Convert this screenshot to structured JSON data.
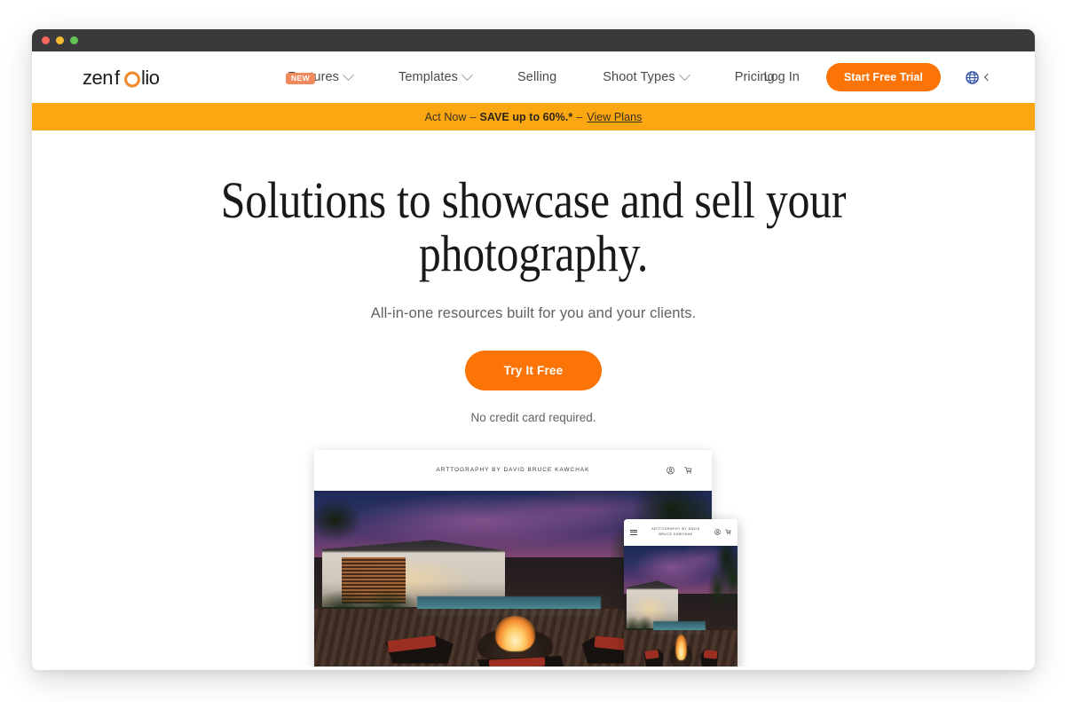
{
  "window": {
    "traffic_lights": [
      "close",
      "minimize",
      "maximize"
    ]
  },
  "nav": {
    "logo_text": "zenfolio",
    "items": [
      {
        "label": "Features",
        "has_caret": true,
        "badge": "NEW"
      },
      {
        "label": "Templates",
        "has_caret": true,
        "badge": ""
      },
      {
        "label": "Selling",
        "has_caret": false,
        "badge": ""
      },
      {
        "label": "Shoot Types",
        "has_caret": true,
        "badge": ""
      },
      {
        "label": "Pricing",
        "has_caret": false,
        "badge": ""
      }
    ],
    "login_label": "Log In",
    "cta_label": "Start Free Trial",
    "language_icon": "globe-icon"
  },
  "promo": {
    "lead": "Act Now",
    "dash1": "–",
    "highlight": "SAVE up to 60%.*",
    "dash2": "–",
    "link_label": "View Plans",
    "background": "#fba711"
  },
  "hero": {
    "headline_line1": "Solutions to showcase and sell your",
    "headline_line2": "photography.",
    "subhead": "All-in-one resources built for you and your clients.",
    "cta_label": "Try It Free",
    "note": "No credit card required."
  },
  "mockup": {
    "desktop": {
      "site_title": "ARTTOGRAPHY BY DAVID BRUCE KAWCHAK",
      "icons": [
        "user-circle-icon",
        "shopping-cart-icon"
      ]
    },
    "mobile": {
      "site_title_line1": "ARTTOGRAPHY BY DAVID",
      "site_title_line2": "BRUCE KAWCHAK",
      "menu_icon": "hamburger-menu-icon",
      "icons": [
        "user-circle-icon",
        "shopping-cart-icon"
      ]
    }
  },
  "colors": {
    "brand_orange": "#fb7405",
    "promo_amber": "#fba711",
    "badge_coral": "#f08a5d",
    "titlebar": "#3a3a3c",
    "text_dark": "#19191b",
    "text_muted": "#5e6366"
  }
}
